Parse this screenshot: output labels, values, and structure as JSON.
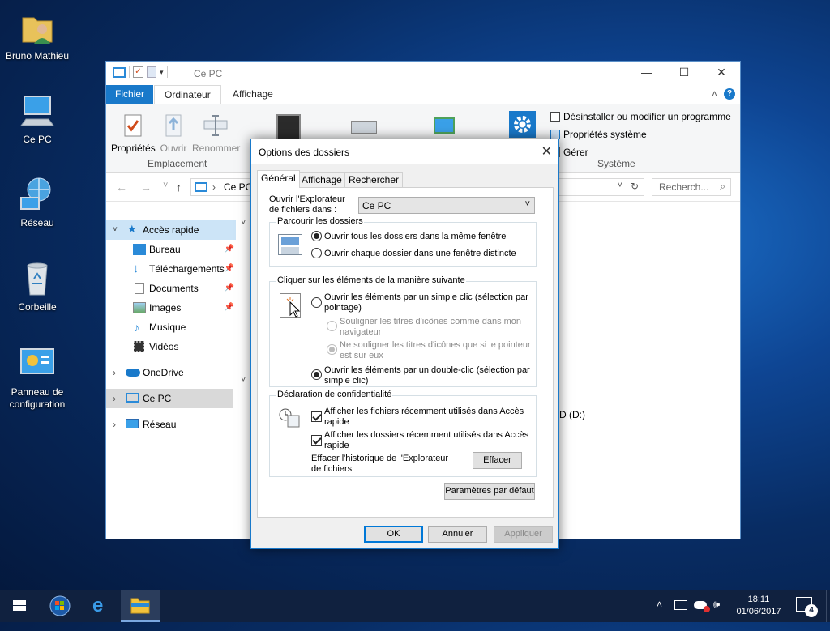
{
  "desktop": {
    "icons": [
      {
        "label": "Bruno Mathieu"
      },
      {
        "label": "Ce PC"
      },
      {
        "label": "Réseau"
      },
      {
        "label": "Corbeille"
      },
      {
        "label": "Panneau de configuration"
      }
    ]
  },
  "explorer": {
    "title": "Ce PC",
    "tabs": {
      "file": "Fichier",
      "computer": "Ordinateur",
      "view": "Affichage"
    },
    "ribbon": {
      "properties": "Propriétés",
      "open": "Ouvrir",
      "rename": "Renommer",
      "group_location": "Emplacement",
      "uninstall": "Désinstaller ou modifier un programme",
      "system_properties": "Propriétés système",
      "manage": "Gérer",
      "group_system": "Système"
    },
    "address": {
      "path": "Ce PC",
      "search_placeholder": "Recherch..."
    },
    "nav": {
      "quick_access": "Accès rapide",
      "desktop": "Bureau",
      "downloads": "Téléchargements",
      "documents": "Documents",
      "images": "Images",
      "music": "Musique",
      "videos": "Vidéos",
      "onedrive": "OneDrive",
      "this_pc": "Ce PC",
      "network": "Réseau"
    },
    "content": {
      "drive_partial": "D (D:)"
    }
  },
  "dialog": {
    "title": "Options des dossiers",
    "tabs": [
      "Général",
      "Affichage",
      "Rechercher"
    ],
    "open_explorer_label": "Ouvrir l'Explorateur de fichiers dans :",
    "open_explorer_value": "Ce PC",
    "browse": {
      "legend": "Parcourir les dossiers",
      "same_window": "Ouvrir tous les dossiers dans la même fenêtre",
      "new_window": "Ouvrir chaque dossier dans une fenêtre distincte"
    },
    "click": {
      "legend": "Cliquer sur les éléments de la manière suivante",
      "single_click": "Ouvrir les éléments par un simple clic (sélection par pointage)",
      "underline_browser": "Souligner les titres d'icônes comme dans mon navigateur",
      "underline_hover": "Ne souligner les titres d'icônes que si le pointeur est sur eux",
      "double_click": "Ouvrir les éléments par un double-clic (sélection par simple clic)"
    },
    "privacy": {
      "legend": "Déclaration de confidentialité",
      "recent_files": "Afficher les fichiers récemment utilisés dans Accès rapide",
      "recent_folders": "Afficher les dossiers récemment utilisés dans Accès rapide",
      "clear_label": "Effacer l'historique de l'Explorateur de fichiers",
      "clear_button": "Effacer"
    },
    "restore_defaults": "Paramètres par défaut",
    "ok": "OK",
    "cancel": "Annuler",
    "apply": "Appliquer"
  },
  "taskbar": {
    "time": "18:11",
    "date": "01/06/2017",
    "notification_count": "4"
  }
}
